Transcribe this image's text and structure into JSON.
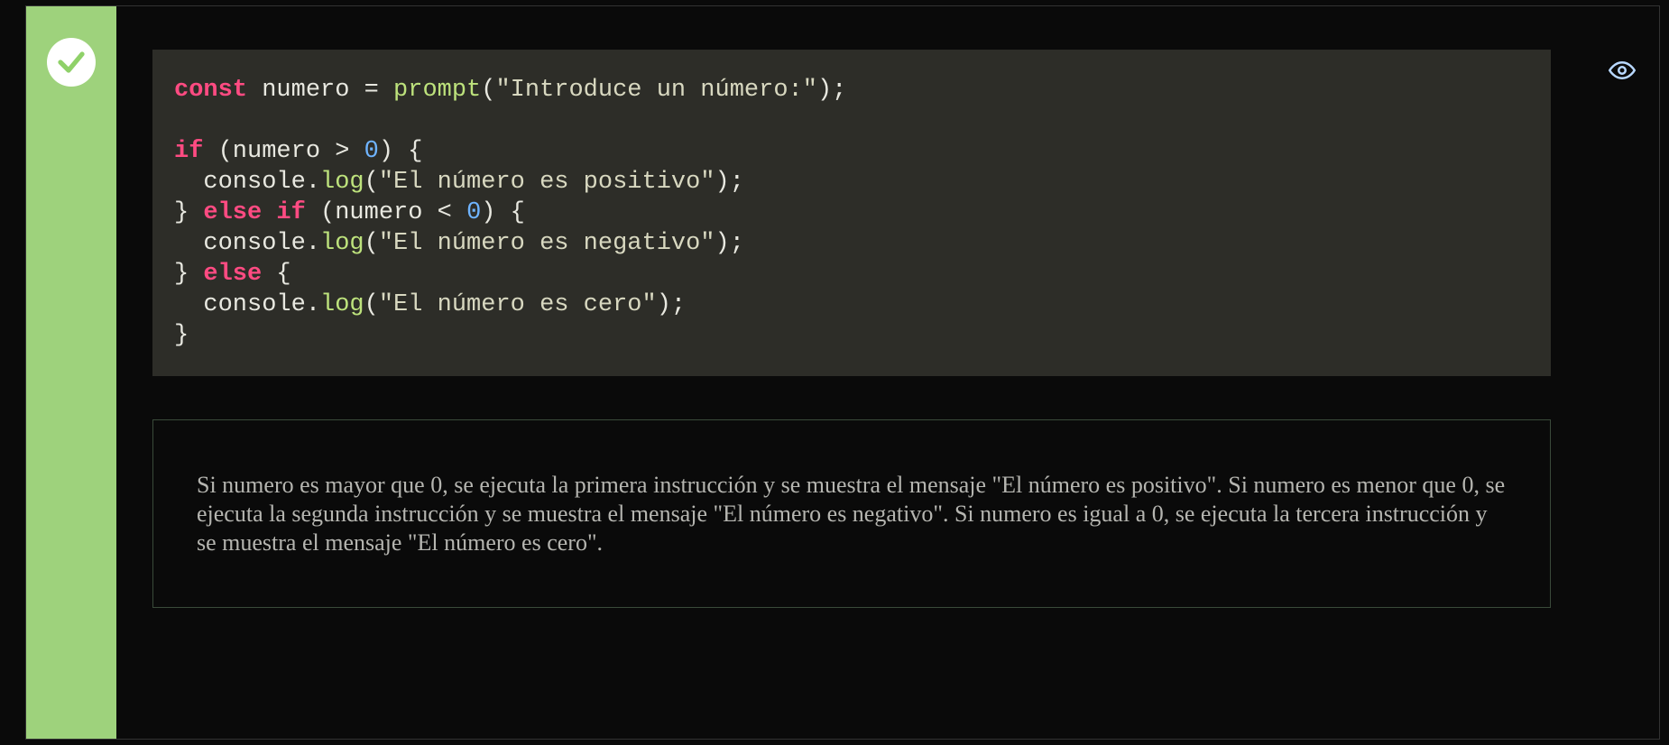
{
  "status": "correct",
  "code": {
    "line1": {
      "kw": "const",
      "var": " numero = ",
      "fn": "prompt",
      "paren": "(",
      "str": "\"Introduce un número:\"",
      "close": ");"
    },
    "line2": "",
    "line3": {
      "kw": "if",
      "open": " (numero > ",
      "num": "0",
      "close": ") {"
    },
    "line4": {
      "indent": "  console.",
      "meth": "log",
      "paren": "(",
      "str": "\"El número es positivo\"",
      "close": ");"
    },
    "line5": {
      "brace": "} ",
      "kw": "else if",
      "open": " (numero < ",
      "num": "0",
      "close": ") {"
    },
    "line6": {
      "indent": "  console.",
      "meth": "log",
      "paren": "(",
      "str": "\"El número es negativo\"",
      "close": ");"
    },
    "line7": {
      "brace": "} ",
      "kw": "else",
      "close": " {"
    },
    "line8": {
      "indent": "  console.",
      "meth": "log",
      "paren": "(",
      "str": "\"El número es cero\"",
      "close": ");"
    },
    "line9": {
      "brace": "}"
    }
  },
  "explanation": "Si numero es mayor que 0, se ejecuta la primera instrucción y se muestra el mensaje \"El número es positivo\". Si numero es menor que 0, se ejecuta la segunda instrucción y se muestra el mensaje \"El número es negativo\". Si numero es igual a 0, se ejecuta la tercera instrucción y se muestra el mensaje \"El número es cero\"."
}
